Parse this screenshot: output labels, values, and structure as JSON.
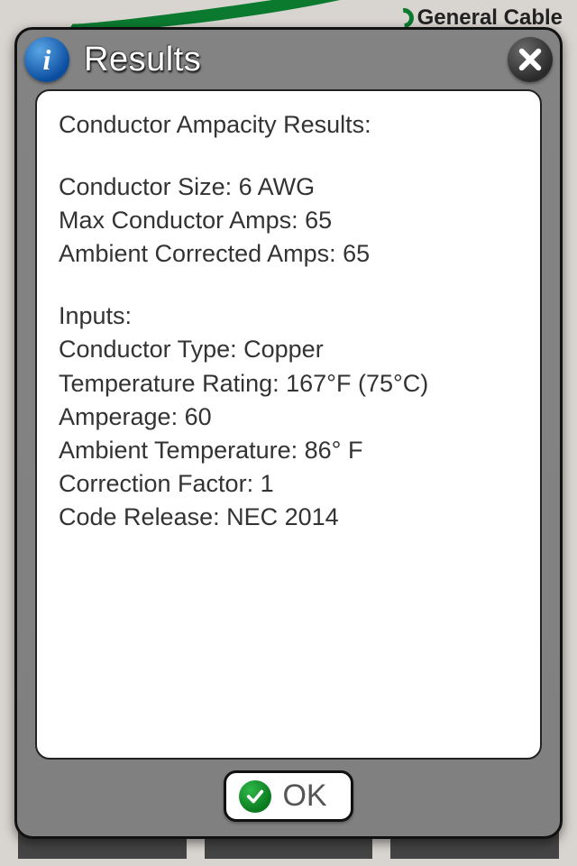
{
  "brand": "General Cable",
  "dialog": {
    "title": "Results",
    "ok_label": "OK",
    "content": {
      "heading": "Conductor Ampacity Results:",
      "conductor_size_label": "Conductor Size:",
      "conductor_size_value": "6 AWG",
      "max_amps_label": "Max Conductor Amps:",
      "max_amps_value": "65",
      "ambient_corrected_label": "Ambient Corrected Amps:",
      "ambient_corrected_value": "65",
      "inputs_heading": "Inputs:",
      "conductor_type_label": "Conductor Type:",
      "conductor_type_value": "Copper",
      "temp_rating_label": "Temperature Rating:",
      "temp_rating_value": "167°F (75°C)",
      "amperage_label": "Amperage:",
      "amperage_value": "60",
      "ambient_temp_label": "Ambient Temperature:",
      "ambient_temp_value": "86° F",
      "correction_factor_label": "Correction Factor:",
      "correction_factor_value": "1",
      "code_release_label": "Code Release:",
      "code_release_value": "NEC 2014"
    }
  }
}
